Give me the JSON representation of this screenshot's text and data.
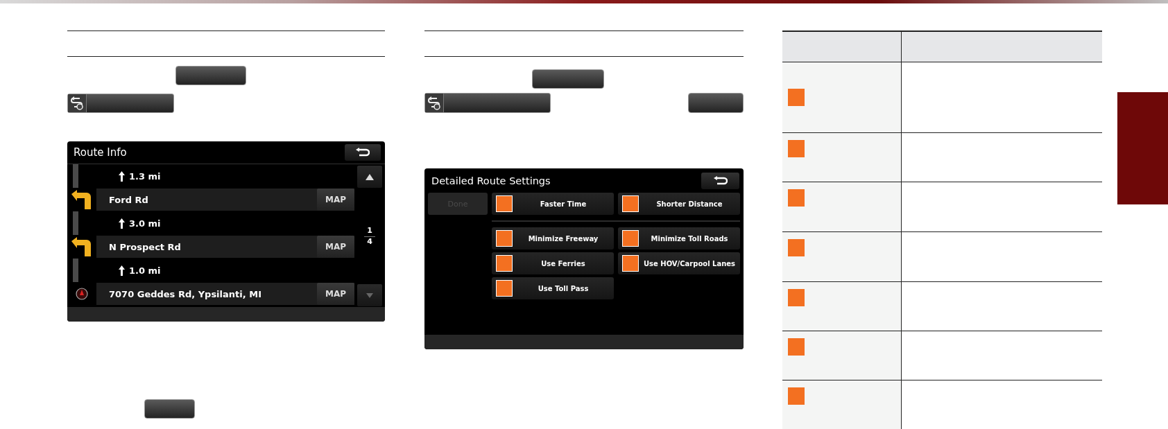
{
  "route_info": {
    "title": "Route Info",
    "rows": [
      {
        "kind": "distance",
        "text": "1.3 mi"
      },
      {
        "kind": "turn",
        "text": "Ford Rd",
        "action": "MAP"
      },
      {
        "kind": "distance",
        "text": "3.0 mi"
      },
      {
        "kind": "turn",
        "text": "N Prospect Rd",
        "action": "MAP"
      },
      {
        "kind": "distance",
        "text": "1.0 mi"
      },
      {
        "kind": "destination",
        "text": "7070 Geddes Rd, Ypsilanti, MI",
        "action": "MAP"
      }
    ],
    "page": {
      "current": "1",
      "total": "4"
    }
  },
  "route_settings": {
    "title": "Detailed Route Settings",
    "done": {
      "label": "Done",
      "disabled": true
    },
    "route_types": [
      "Faster Time",
      "Shorter Distance"
    ],
    "avoid_options": [
      "Minimize Freeway",
      "Minimize Toll Roads",
      "Use Ferries",
      "Use HOV/Carpool Lanes",
      "Use Toll Pass"
    ]
  }
}
